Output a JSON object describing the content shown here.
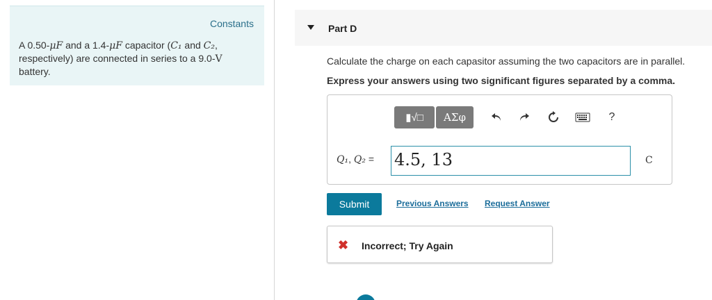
{
  "sidebar": {
    "constants_label": "Constants",
    "problem": {
      "t1": "A 0.50-",
      "unit1": "μF",
      "t2": " and a 1.4-",
      "unit2": "μF",
      "t3": " capacitor (",
      "c1": "C₁",
      "t4": " and ",
      "c2": "C₂",
      "t5": ", respectively) are connected in series to a 9.0-",
      "volt": "V",
      "t6": " battery."
    }
  },
  "part": {
    "title": "Part D",
    "question": "Calculate the charge on each capasitor assuming the two capacitors are in parallel.",
    "instruction": "Express your answers using two significant figures separated by a comma."
  },
  "toolbar": {
    "templates_icon": "▮√□",
    "greek_label": "ΑΣφ",
    "undo_icon": "undo-arrow",
    "redo_icon": "redo-arrow",
    "reset_icon": "reset-circle",
    "keyboard_icon": "keyboard",
    "help_label": "?"
  },
  "answer": {
    "label_q1": "Q₁",
    "label_sep": ", ",
    "label_q2": "Q₂",
    "label_eq": " =",
    "value": "4.5, 13",
    "unit": "C"
  },
  "actions": {
    "submit_label": "Submit",
    "previous_answers_label": "Previous Answers",
    "request_answer_label": "Request Answer"
  },
  "feedback": {
    "icon": "✖",
    "text": "Incorrect; Try Again"
  },
  "colors": {
    "sidebar_bg": "#e9f5f6",
    "submit_bg": "#0b7a9c",
    "error_red": "#d0302b",
    "input_border": "#2a8fa8"
  }
}
